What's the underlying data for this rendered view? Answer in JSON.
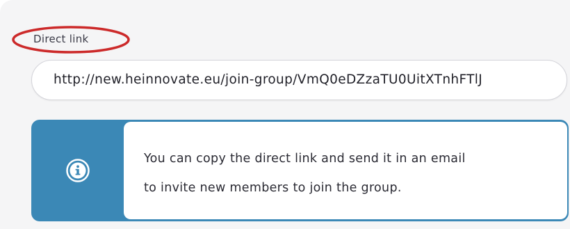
{
  "direct_link": {
    "label": "Direct link",
    "value": "http://new.heinnovate.eu/join-group/VmQ0eDZzaTU0UitXTnhFTlJ"
  },
  "info": {
    "icon": "info-icon",
    "lines": [
      "You can copy the direct link and send it in an email",
      "to invite new members to join the group."
    ]
  },
  "colors": {
    "annotation": "#cc2a2a",
    "info_accent": "#3b88b6"
  }
}
